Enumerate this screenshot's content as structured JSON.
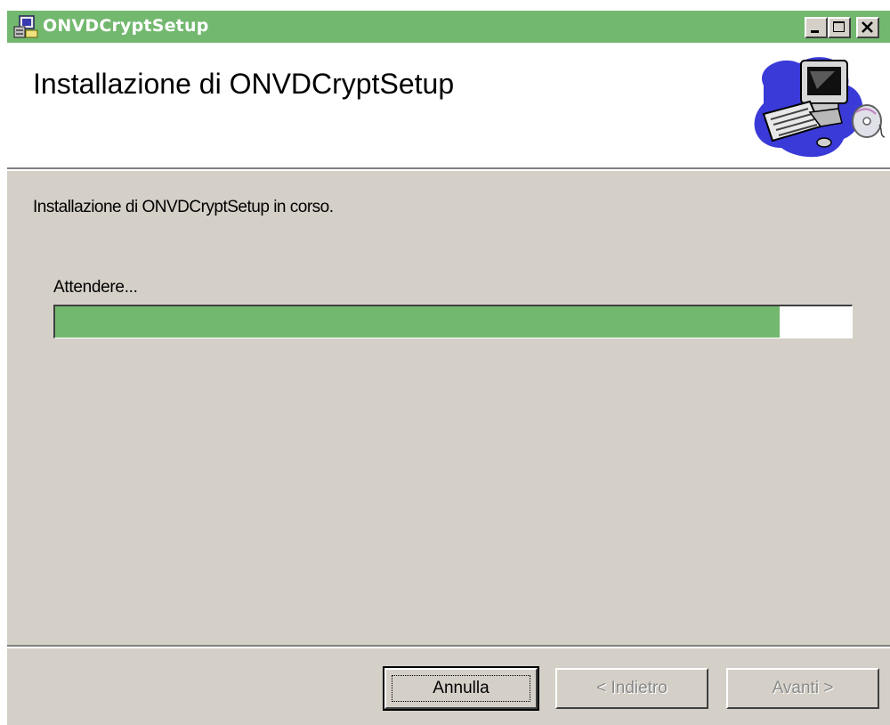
{
  "window": {
    "title": "ONVDCryptSetup",
    "title_icon": "installer-icon",
    "controls": [
      "minimize-icon",
      "maximize-icon",
      "close-icon"
    ]
  },
  "banner": {
    "title": "Installazione di ONVDCryptSetup",
    "image": "computer-cd-illustration"
  },
  "body": {
    "status_text": "Installazione di ONVDCryptSetup in corso.",
    "wait_label": "Attendere...",
    "progress_fraction": 0.91
  },
  "buttons": {
    "cancel": "Annulla",
    "back": "< Indietro",
    "next": "Avanti >"
  },
  "colors": {
    "titlebar": "#73b86f",
    "progress": "#73b86f",
    "face": "#d4d0c8"
  }
}
